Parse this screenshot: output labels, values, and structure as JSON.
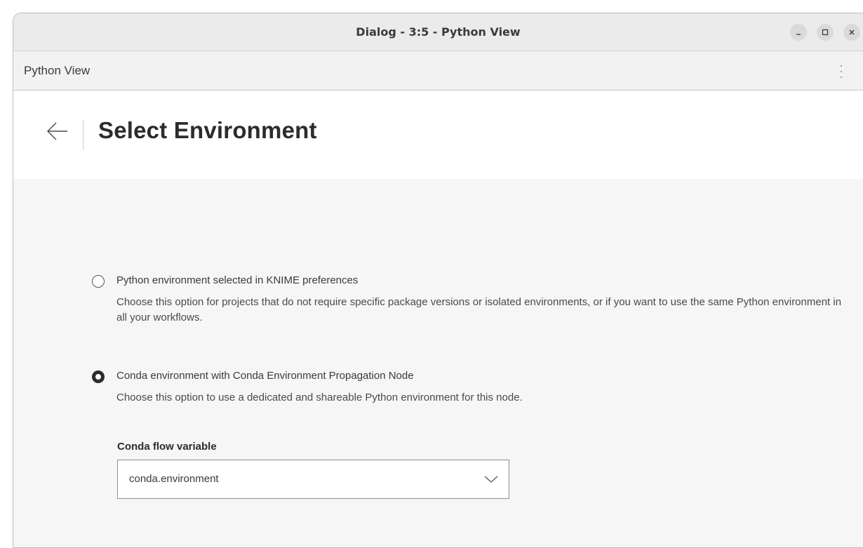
{
  "window": {
    "title": "Dialog - 3:5 - Python View",
    "controls": {
      "minimize_icon": "minimize-icon",
      "maximize_icon": "maximize-icon",
      "close_icon": "close-icon"
    }
  },
  "menubar": {
    "title": "Python View",
    "menu_icon": "kebab-menu-icon"
  },
  "page": {
    "back_icon": "back-arrow-icon",
    "title": "Select Environment"
  },
  "options": [
    {
      "label": "Python environment selected in KNIME preferences",
      "description": "Choose this option for projects that do not require specific package versions or isolated environments, or if you want to use the same Python environment in all your workflows.",
      "selected": false
    },
    {
      "label": "Conda environment with Conda Environment Propagation Node",
      "description": "Choose this option to use a dedicated and shareable Python environment for this node.",
      "selected": true
    }
  ],
  "conda": {
    "field_label": "Conda flow variable",
    "selected_value": "conda.environment",
    "dropdown_icon": "chevron-down-icon"
  },
  "colors": {
    "titlebar_bg": "#ebebeb",
    "content_bg": "#f6f6f6",
    "header_bg": "#ffffff",
    "text": "#3a3a3a"
  }
}
